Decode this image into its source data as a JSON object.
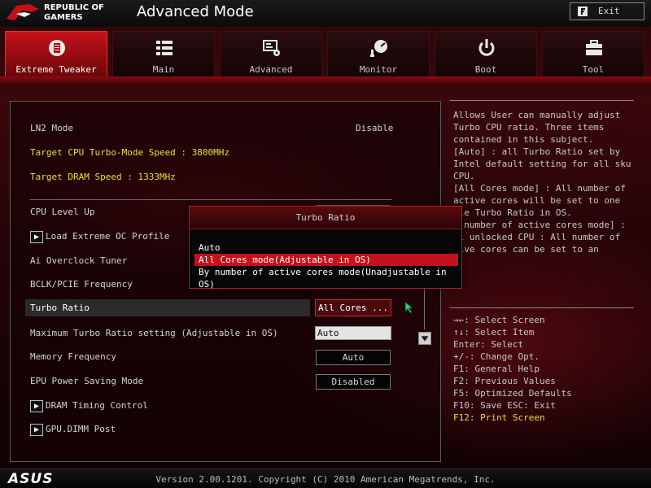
{
  "header": {
    "brand_line1": "REPUBLIC OF",
    "brand_line2": "GAMERS",
    "title": "Advanced Mode",
    "exit_label": "Exit"
  },
  "tabs": [
    {
      "label": "Extreme Tweaker",
      "icon": "tweaker-icon",
      "active": true
    },
    {
      "label": "Main",
      "icon": "list-icon",
      "active": false
    },
    {
      "label": "Advanced",
      "icon": "advanced-settings-icon",
      "active": false
    },
    {
      "label": "Monitor",
      "icon": "monitor-gauge-icon",
      "active": false
    },
    {
      "label": "Boot",
      "icon": "power-icon",
      "active": false
    },
    {
      "label": "Tool",
      "icon": "toolbox-icon",
      "active": false
    }
  ],
  "settings": {
    "ln2_label": "LN2 Mode",
    "ln2_value": "Disable",
    "target_cpu": "Target CPU Turbo-Mode Speed : 3800MHz",
    "target_dram": "Target DRAM Speed : 1333MHz",
    "cpu_level_up": "CPU Level Up",
    "load_extreme_oc": "Load Extreme OC Profile",
    "ai_overclock": "Ai Overclock Tuner",
    "bclk_pcie": "BCLK/PCIE Frequency",
    "turbo_ratio_label": "Turbo Ratio",
    "turbo_ratio_value": "All Cores ...",
    "max_turbo_label": "Maximum Turbo Ratio setting (Adjustable in OS)",
    "max_turbo_value": "Auto",
    "memory_freq_label": "Memory Frequency",
    "memory_freq_value": "Auto",
    "epu_label": "EPU Power Saving Mode",
    "epu_value": "Disabled",
    "dram_timing": "DRAM Timing Control",
    "gpu_dimm": "GPU.DIMM Post"
  },
  "popup": {
    "title": "Turbo Ratio",
    "options": [
      "Auto",
      "All Cores mode(Adjustable in OS)",
      "By number of active cores mode(Unadjustable in OS)"
    ],
    "selected_index": 1
  },
  "help": {
    "text": "Allows User can manually adjust\nTurbo CPU ratio. Three items\ncontained in this subject.\n[Auto] : all Turbo Ratio set by\nIntel default setting for all sku\nCPU.\n[All Cores mode] : All number of\nactive cores will be set to one\ngle Turbo Ratio in OS.\ny number of active cores mode] :\nll unlocked CPU : All number of\ntive cores can be set to an",
    "keys": [
      "→←: Select Screen",
      "↑↓: Select Item",
      "Enter: Select",
      "+/-: Change Opt.",
      "F1: General Help",
      "F2: Previous Values",
      "F5: Optimized Defaults",
      "F10: Save  ESC: Exit",
      "F12: Print Screen"
    ]
  },
  "footer": {
    "logo": "ASUS",
    "version": "Version 2.00.1201. Copyright (C) 2010 American Megatrends, Inc."
  },
  "colors": {
    "accent_red": "#c4111a",
    "info_yellow": "#f0dc3a"
  }
}
